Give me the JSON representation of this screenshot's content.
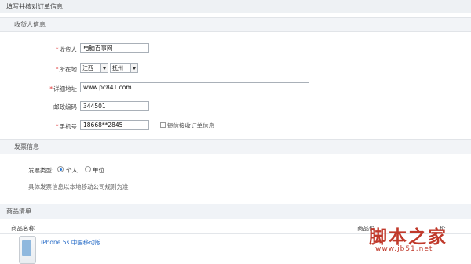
{
  "page_title": "填写并核对订单信息",
  "receiver_section": {
    "title": "收货人信息",
    "name_label": "收货人",
    "name_value": "电脑百事网",
    "region_label": "所在地",
    "province": "江西",
    "city": "抚州",
    "address_label": "详细地址",
    "address_value": "www.pc841.com",
    "zip_label": "邮政编码",
    "zip_value": "344501",
    "phone_label": "手机号",
    "phone_value": "18668**2845",
    "sms_label": "短信接收订单信息"
  },
  "invoice_section": {
    "title": "发票信息",
    "type_label": "发票类型:",
    "option_personal": "个人",
    "option_company": "单位",
    "note": "具体发票信息以本地移动公司规则为准"
  },
  "products_section": {
    "title": "商品清单",
    "col_name": "商品名称",
    "col_product": "商品价",
    "col_price": "价",
    "item_name": "iPhone 5s 中国移动版"
  },
  "watermark": {
    "main": "脚本之家",
    "url": "www.jb51.net"
  }
}
